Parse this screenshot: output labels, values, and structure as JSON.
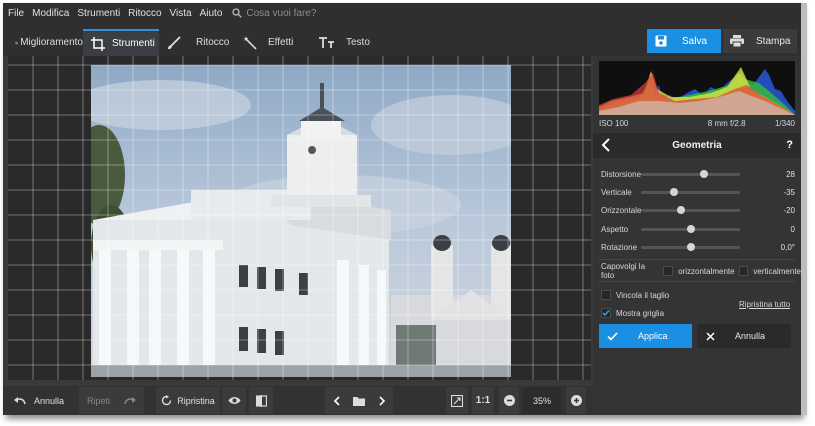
{
  "menu": {
    "items": [
      "File",
      "Modifica",
      "Strumenti",
      "Ritocco",
      "Vista",
      "Aiuto"
    ],
    "search_placeholder": "Cosa vuoi fare?"
  },
  "tabs": {
    "miglioramento": "Miglioramento",
    "strumenti": "Strumenti",
    "ritocco": "Ritocco",
    "effetti": "Effetti",
    "testo": "Testo"
  },
  "actions": {
    "save": "Salva",
    "print": "Stampa"
  },
  "histogram_info": {
    "iso": "ISO 100",
    "lens": "8 mm f/2.8",
    "shutter": "1/340"
  },
  "geometry": {
    "title": "Geometria",
    "help": "?",
    "sliders": [
      {
        "label": "Distorsione",
        "value": "28",
        "level": 0.64
      },
      {
        "label": "Verticale",
        "value": "-35",
        "level": 0.33
      },
      {
        "label": "Orizzontale",
        "value": "-20",
        "level": 0.4
      },
      {
        "label": "Aspetto",
        "value": "0",
        "level": 0.5
      },
      {
        "label": "Rotazione",
        "value": "0,0°",
        "level": 0.5
      }
    ],
    "flip_label": "Capovolgi la foto",
    "flip_horizontal": "orizzontalmente",
    "flip_vertical": "verticalmente",
    "constrain_crop": "Vincola il taglio",
    "reset_all": "Ripristina tutto",
    "show_grid": "Mostra griglia",
    "show_grid_checked": true,
    "apply": "Applica",
    "cancel": "Annulla"
  },
  "bottom": {
    "undo": "Annulla",
    "redo": "Ripeti",
    "reset": "Ripristina",
    "one_to_one": "1:1",
    "zoom": "35%"
  },
  "colors": {
    "accent": "#1a8fe3",
    "panel": "#333436",
    "canvas": "#2a2a2a"
  }
}
